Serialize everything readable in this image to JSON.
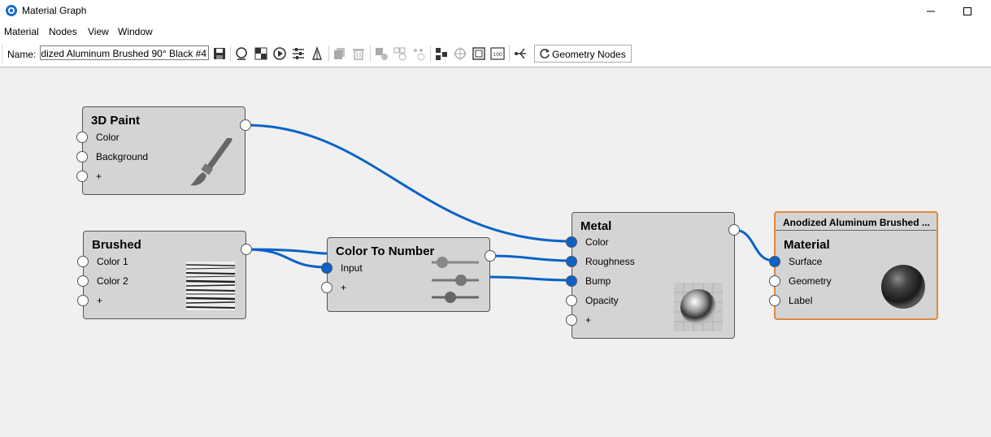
{
  "window": {
    "title": "Material Graph"
  },
  "menu": [
    "Material",
    "Nodes",
    "View",
    "Window"
  ],
  "toolbar": {
    "name_label": "Name:",
    "name_value": "odized Aluminum Brushed 90° Black #4",
    "geometry_button": "Geometry Nodes"
  },
  "nodes": {
    "paint": {
      "title": "3D Paint",
      "ports": [
        "Color",
        "Background",
        "+"
      ]
    },
    "brushed": {
      "title": "Brushed",
      "ports": [
        "Color 1",
        "Color 2",
        "+"
      ]
    },
    "ctn": {
      "title": "Color To Number",
      "ports": [
        "Input",
        "+"
      ]
    },
    "metal": {
      "title": "Metal",
      "ports": [
        "Color",
        "Roughness",
        "Bump",
        "Opacity",
        "+"
      ]
    },
    "material": {
      "header": "Anodized Aluminum Brushed ...",
      "title": "Material",
      "ports": [
        "Surface",
        "Geometry",
        "Label"
      ]
    }
  },
  "colors": {
    "wire": "#0a63c7",
    "selection": "#e08a3c",
    "node": "#d4d4d4"
  }
}
